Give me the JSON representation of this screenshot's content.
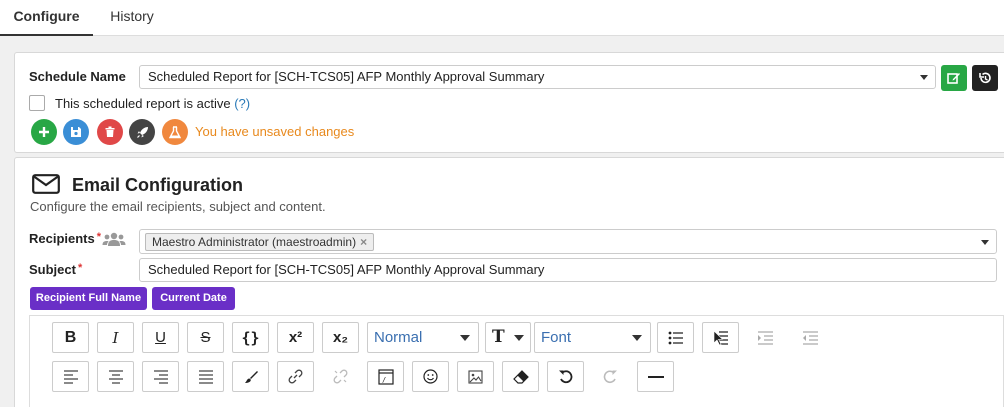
{
  "tabs": [
    {
      "label": "Configure",
      "active": true
    },
    {
      "label": "History",
      "active": false
    }
  ],
  "schedule": {
    "name_label": "Schedule Name",
    "name_value": "Scheduled Report for [SCH-TCS05] AFP Monthly Approval Summary",
    "active_label": "This scheduled report is active",
    "active_help": "(?)",
    "active_checked": false,
    "unsaved_text": "You have unsaved changes"
  },
  "email": {
    "title": "Email Configuration",
    "description": "Configure the email recipients, subject and content.",
    "recipients_label": "Recipients",
    "required_mark": "*",
    "recipient_chip": "Maestro Administrator (maestroadmin)",
    "chip_remove": "×",
    "subject_label": "Subject",
    "subject_value": "Scheduled Report for [SCH-TCS05] AFP Monthly Approval Summary",
    "placeholders": [
      "Recipient Full Name",
      "Current Date"
    ]
  },
  "editor": {
    "format_value": "Normal",
    "font_value": "Font",
    "bold": "B",
    "italic": "I",
    "underline": "U",
    "strike": "S",
    "code": "{}",
    "superscript": "x²",
    "subscript": "x₂"
  },
  "colors": {
    "green": "#28a745",
    "blue": "#3a8ed6",
    "red": "#e04848",
    "dark": "#444444",
    "orange": "#f0883e",
    "purple": "#6a2fc7",
    "warning": "#e8891d"
  }
}
